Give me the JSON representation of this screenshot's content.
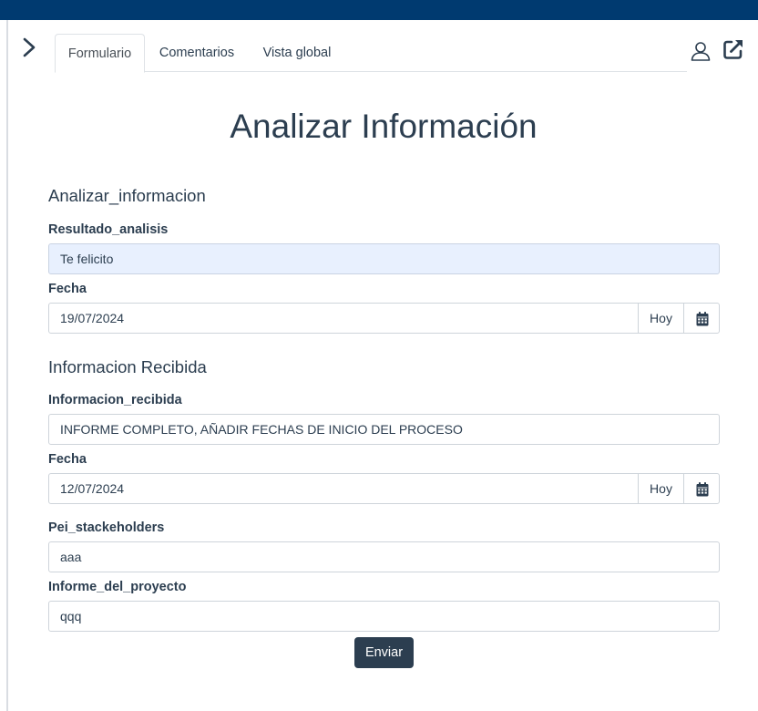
{
  "tabs": [
    {
      "label": "Formulario",
      "active": true
    },
    {
      "label": "Comentarios",
      "active": false
    },
    {
      "label": "Vista global",
      "active": false
    }
  ],
  "icons": {
    "expand": "chevron-right-icon",
    "user": "user-icon",
    "popout": "external-link-icon",
    "calendar": "calendar-icon"
  },
  "colors": {
    "topbar": "#003a70",
    "text": "#2c3e50",
    "button": "#2c3e50",
    "filled_input": "#e8f0fe"
  },
  "page_title": "Analizar Información",
  "section1": {
    "title": "Analizar_informacion",
    "resultado_label": "Resultado_analisis",
    "resultado_value": "Te felicito",
    "fecha_label": "Fecha",
    "fecha_value": "19/07/2024",
    "hoy_label": "Hoy"
  },
  "section2": {
    "title": "Informacion Recibida",
    "informacion_label": "Informacion_recibida",
    "informacion_value": "INFORME COMPLETO, AÑADIR FECHAS DE INICIO DEL PROCESO",
    "fecha_label": "Fecha",
    "fecha_value": "12/07/2024",
    "hoy_label": "Hoy",
    "pei_label": "Pei_stackeholders",
    "pei_value": "aaa",
    "informe_label": "Informe_del_proyecto",
    "informe_value": "qqq"
  },
  "submit_label": "Enviar"
}
